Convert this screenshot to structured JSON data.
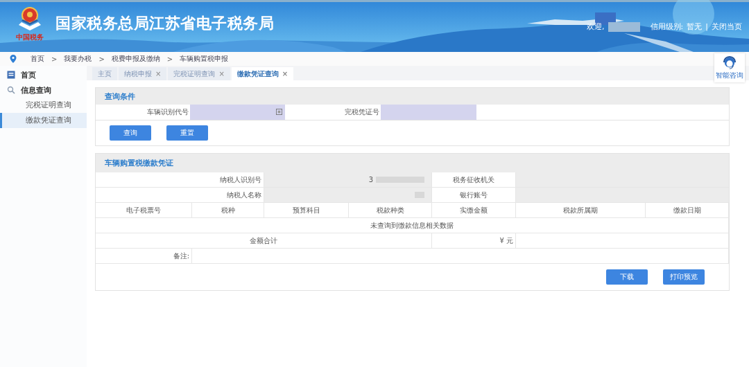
{
  "header": {
    "title": "国家税务总局江苏省电子税务局",
    "logo_caption": "中国税务",
    "welcome": "欢迎,",
    "credit_label": "信用级别:",
    "credit_value": "暂无",
    "separator": "|",
    "close_page": "关闭当页"
  },
  "breadcrumb": [
    {
      "label": "首页"
    },
    {
      "sep": ">",
      "label": "我要办税"
    },
    {
      "sep": ">",
      "label": "税费申报及缴纳"
    },
    {
      "sep": ">",
      "label": "车辆购置税申报"
    }
  ],
  "assistant": {
    "label": "智能咨询"
  },
  "sidebar": {
    "items": [
      {
        "label": "首页",
        "kind": "home"
      },
      {
        "label": "信息查询",
        "kind": "search",
        "children": [
          {
            "label": "完税证明查询",
            "selected": false
          },
          {
            "label": "缴款凭证查询",
            "selected": true
          }
        ]
      }
    ]
  },
  "tabs": [
    {
      "label": "主页",
      "selected": false
    },
    {
      "label": "纳税申报",
      "close": "×",
      "selected": false
    },
    {
      "label": "完税证明查询",
      "close": "×",
      "selected": false
    },
    {
      "label": "缴款凭证查询",
      "close": "×",
      "selected": true
    }
  ],
  "query": {
    "title": "查询条件",
    "fields": [
      {
        "label": "车辆识别代号",
        "kind": "picker"
      },
      {
        "label": "完税凭证号",
        "kind": "text"
      }
    ],
    "buttons": [
      "查询",
      "重置"
    ]
  },
  "voucher": {
    "title": "车辆购置税缴款凭证",
    "info": [
      {
        "label": "纳税人识别号",
        "value": "3",
        "label2": "税务征收机关"
      },
      {
        "label": "纳税人名称",
        "label2": "银行账号"
      }
    ],
    "columns": [
      "电子税票号",
      "税种",
      "预算科目",
      "税款种类",
      "实缴金额",
      "税款所属期",
      "缴款日期"
    ],
    "empty_message": "未查询到缴款信息相关数据",
    "total_label": "金额合计",
    "total_value": "¥ 元",
    "note_label": "备注:",
    "buttons": [
      "下载",
      "打印预览"
    ]
  }
}
